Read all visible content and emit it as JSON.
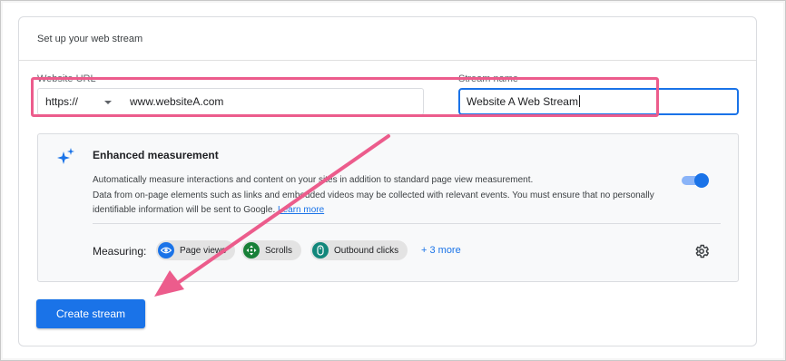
{
  "card": {
    "title": "Set up your web stream"
  },
  "website_url": {
    "label": "Website URL",
    "protocol": "https://",
    "value": "www.websiteA.com"
  },
  "stream_name": {
    "label": "Stream name",
    "value": "Website A Web Stream"
  },
  "enhanced": {
    "title": "Enhanced measurement",
    "description_line1": "Automatically measure interactions and content on your sites in addition to standard page view measurement.",
    "description_line2": "Data from on-page elements such as links and embedded videos may be collected with relevant events. You must ensure that no personally identifiable information will be sent to Google.",
    "learn_more": "Learn more",
    "toggle_on": true,
    "measuring_label": "Measuring:",
    "chips": [
      {
        "label": "Page views",
        "icon": "eye-icon",
        "color": "#1a73e8"
      },
      {
        "label": "Scrolls",
        "icon": "scroll-arrows-icon",
        "color": "#188038"
      },
      {
        "label": "Outbound clicks",
        "icon": "mouse-icon",
        "color": "#12877b"
      }
    ],
    "more_link": "+ 3 more"
  },
  "create_button": {
    "label": "Create stream"
  },
  "annotation": {
    "highlight_color": "#ec5c8c"
  }
}
